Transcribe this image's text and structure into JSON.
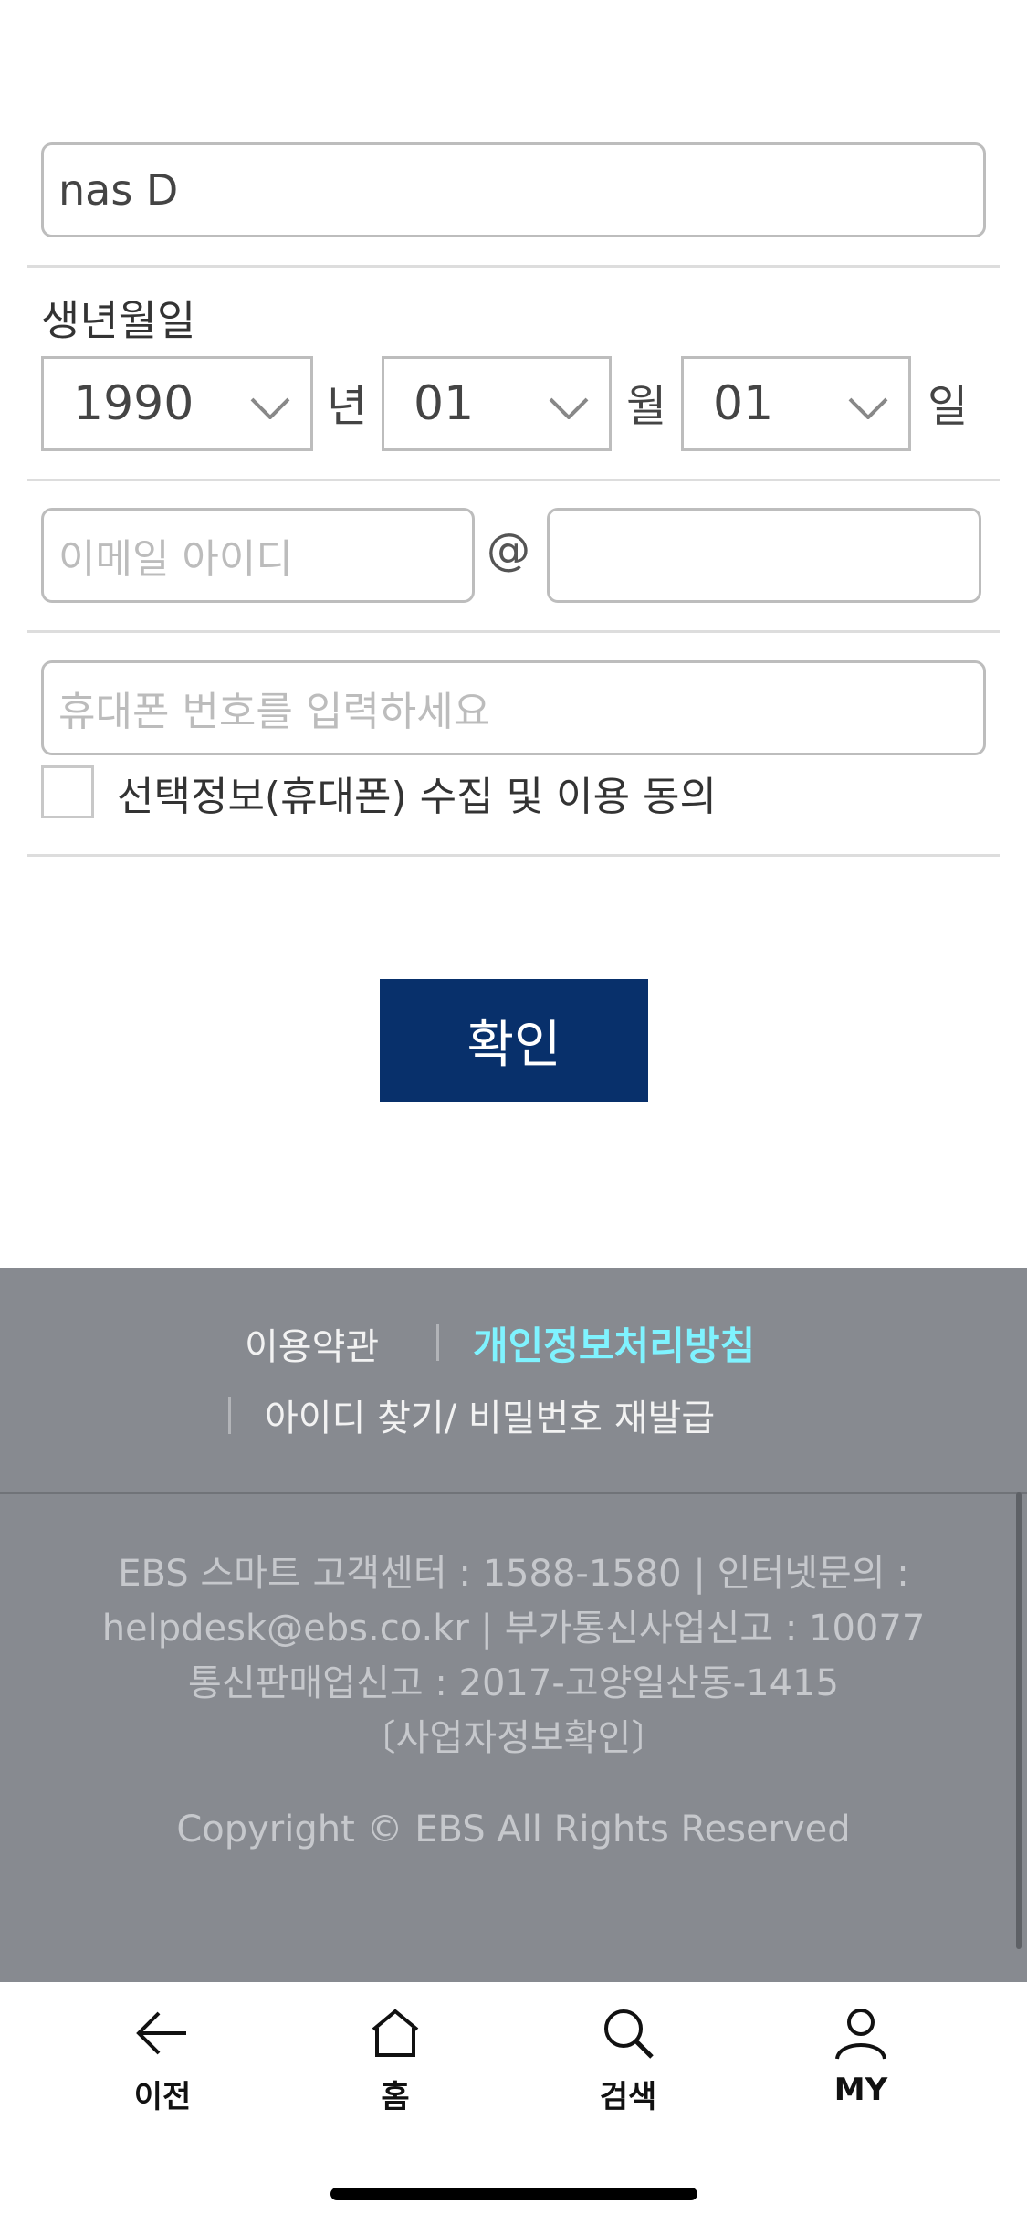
{
  "form": {
    "name_value": "nas D",
    "birth_label": "생년월일",
    "year_value": "1990",
    "year_unit": "년",
    "month_value": "01",
    "month_unit": "월",
    "day_value": "01",
    "day_unit": "일",
    "email_id_placeholder": "이메일 아이디",
    "email_at": "@",
    "email_domain_value": "",
    "phone_placeholder": "휴대폰 번호를 입력하세요",
    "consent_label": "선택정보(휴대폰) 수집 및 이용 동의",
    "confirm_label": "확인"
  },
  "footer": {
    "terms_link": "이용약관",
    "privacy_link": "개인정보처리방침",
    "find_account_link": "아이디 찾기/ 비밀번호 재발급",
    "info_line1": "EBS 스마트 고객센터 : 1588-1580  |   인터넷문의 :",
    "info_line2": "helpdesk@ebs.co.kr   |  부가통신사업신고 : 10077",
    "info_line3": "통신판매업신고 : 2017-고양일산동-1415",
    "info_line4": "〔사업자정보확인〕",
    "copyright": "Copyright © EBS All Rights Reserved",
    "highlight_color": "#7ff3ff"
  },
  "tabbar": {
    "items": [
      {
        "label": "이전",
        "icon": "arrow-left-icon"
      },
      {
        "label": "홈",
        "icon": "home-icon"
      },
      {
        "label": "검색",
        "icon": "search-icon"
      },
      {
        "label": "MY",
        "icon": "user-icon"
      }
    ]
  },
  "colors": {
    "primary_button": "#08306b",
    "footer_bg": "#878a90"
  }
}
